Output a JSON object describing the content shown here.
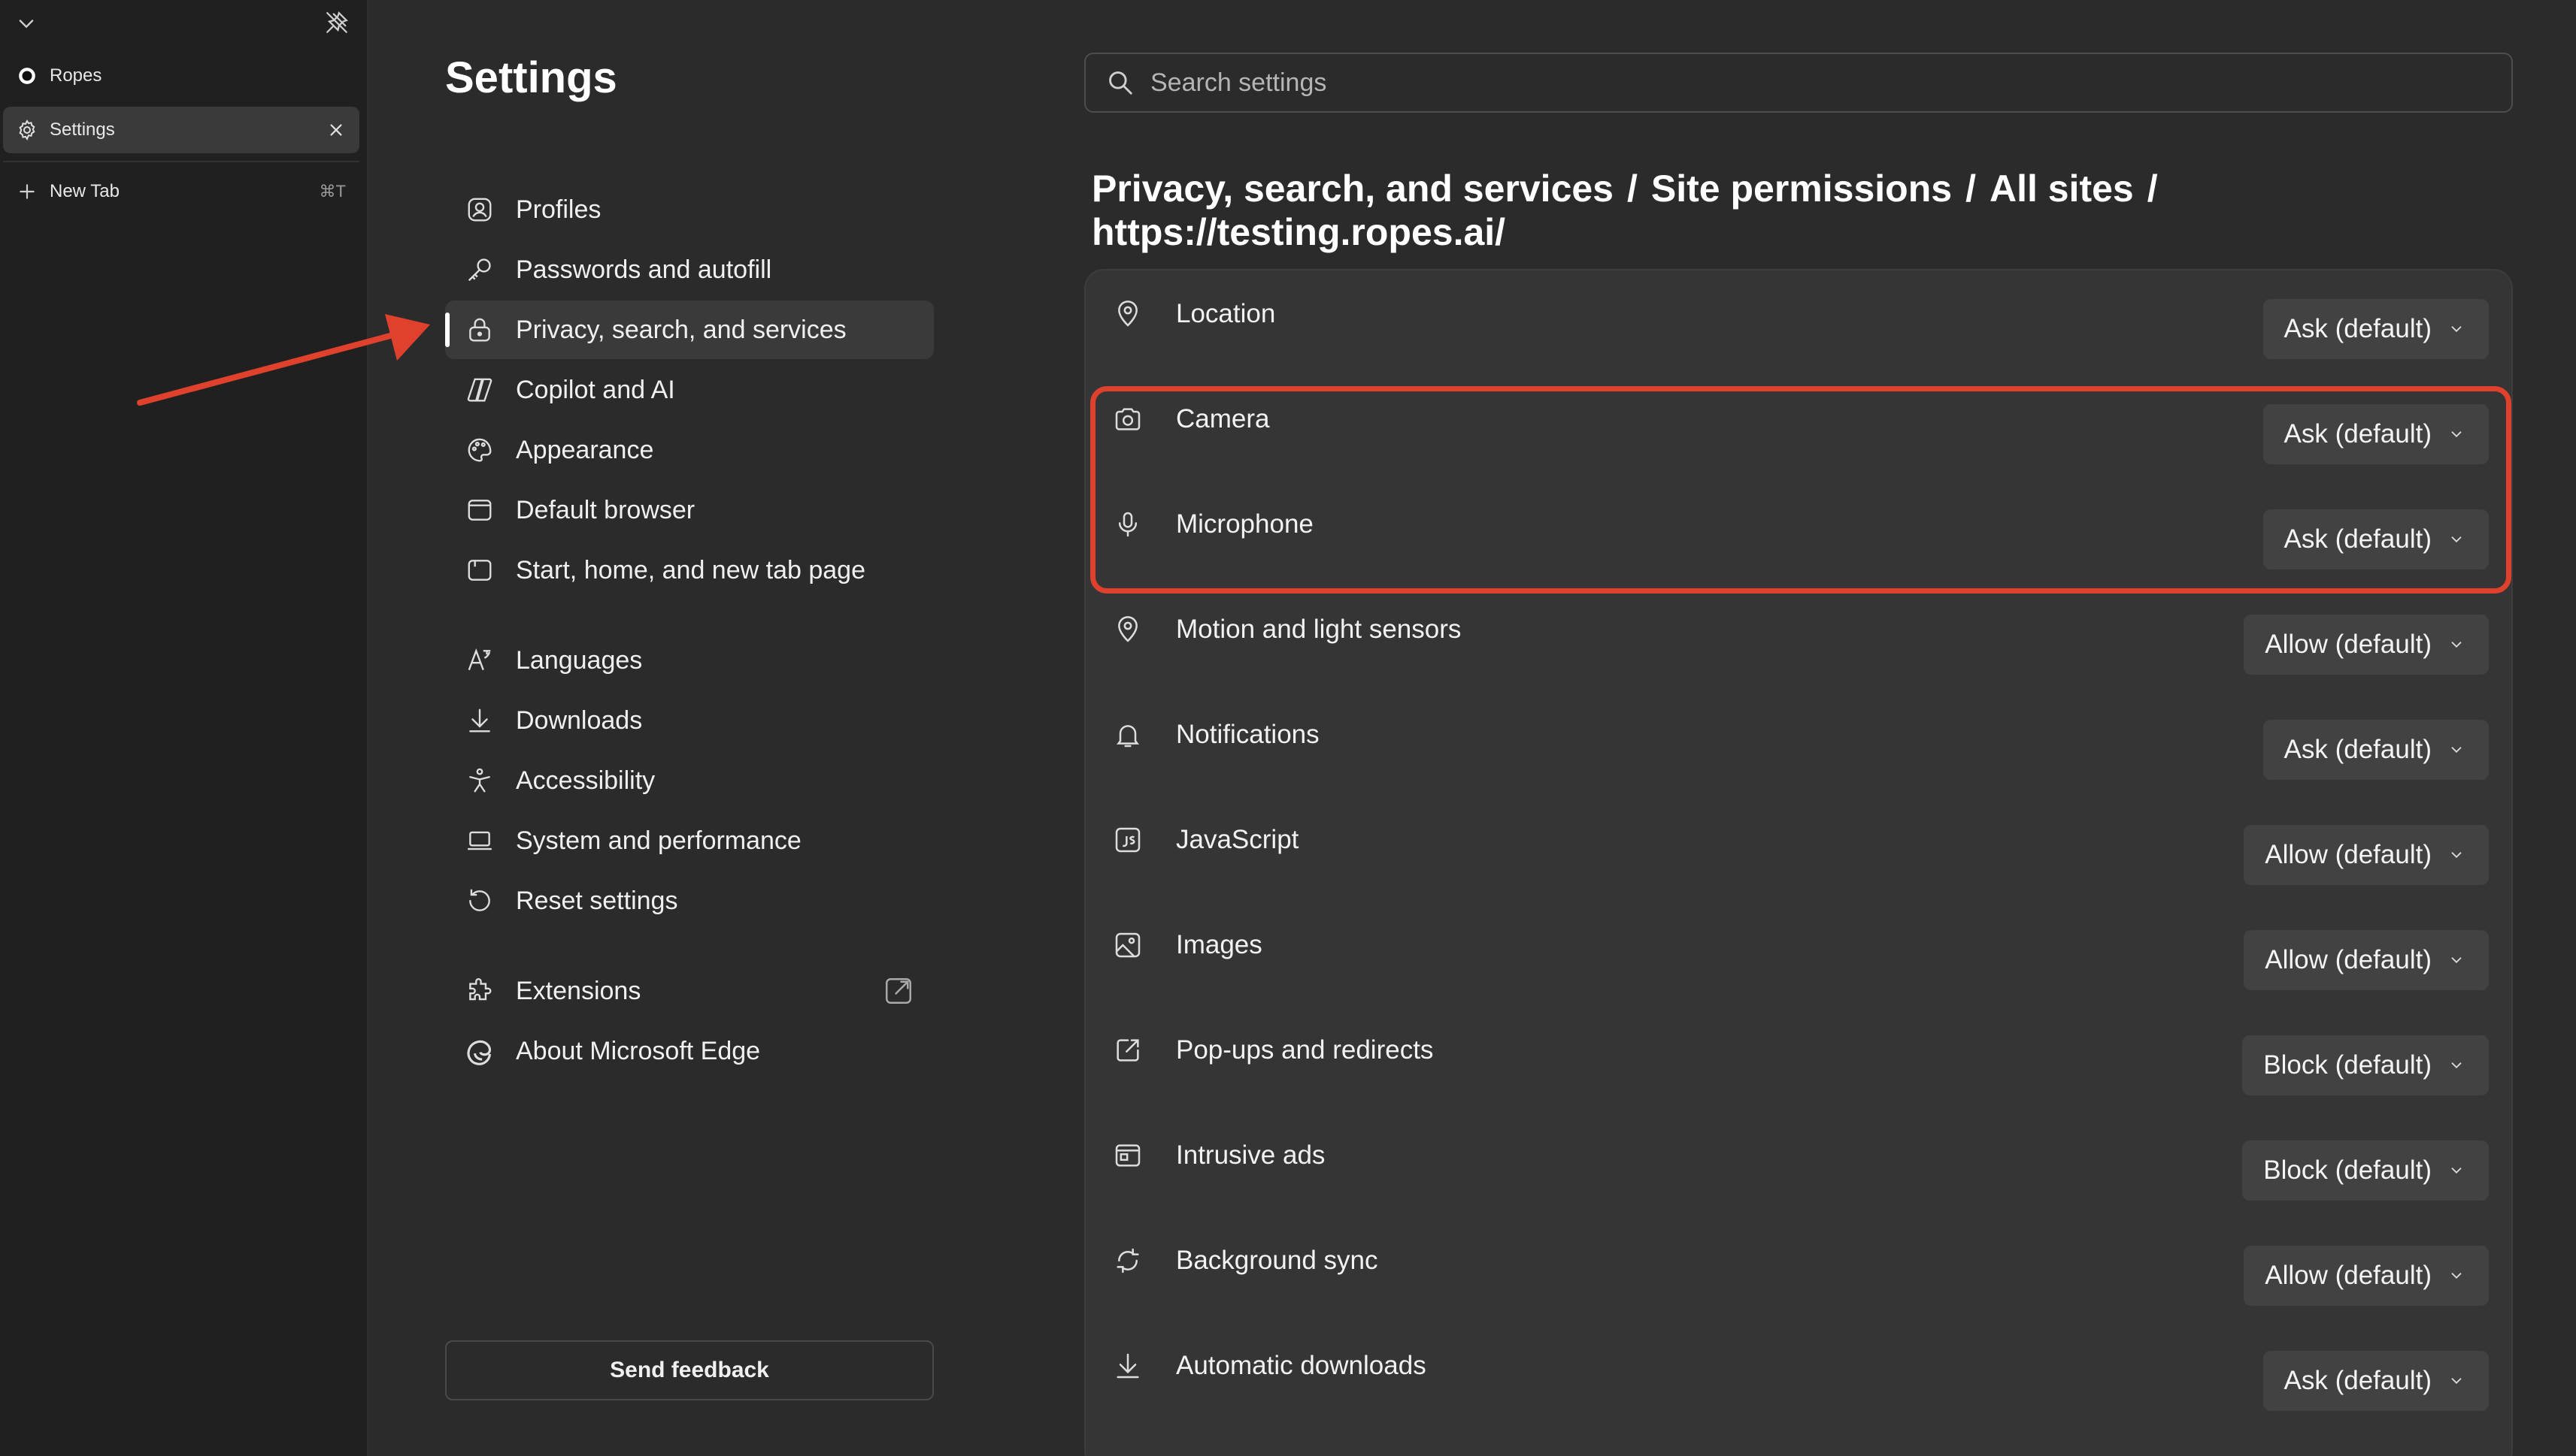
{
  "tabbar": {
    "tabs": [
      {
        "label": "Ropes",
        "icon": "site-dot-icon"
      },
      {
        "label": "Settings",
        "icon": "gear-icon",
        "active": true
      }
    ],
    "new_tab": {
      "label": "New Tab",
      "shortcut": "⌘T"
    }
  },
  "settings": {
    "title": "Settings",
    "nav": [
      {
        "label": "Profiles",
        "icon": "profile-icon"
      },
      {
        "label": "Passwords and autofill",
        "icon": "key-icon"
      },
      {
        "label": "Privacy, search, and services",
        "icon": "lock-icon",
        "active": true
      },
      {
        "label": "Copilot and AI",
        "icon": "copilot-icon"
      },
      {
        "label": "Appearance",
        "icon": "palette-icon"
      },
      {
        "label": "Default browser",
        "icon": "browser-icon"
      },
      {
        "label": "Start, home, and new tab page",
        "icon": "home-page-icon"
      },
      {
        "label": "Languages",
        "icon": "languages-icon"
      },
      {
        "label": "Downloads",
        "icon": "download-icon"
      },
      {
        "label": "Accessibility",
        "icon": "accessibility-icon"
      },
      {
        "label": "System and performance",
        "icon": "laptop-icon"
      },
      {
        "label": "Reset settings",
        "icon": "reset-icon"
      },
      {
        "label": "Extensions",
        "icon": "puzzle-icon"
      },
      {
        "label": "About Microsoft Edge",
        "icon": "edge-icon"
      }
    ],
    "feedback_label": "Send feedback"
  },
  "search": {
    "placeholder": "Search settings"
  },
  "breadcrumb": {
    "part1": "Privacy, search, and services",
    "part2": "Site permissions",
    "part3": "All sites",
    "part4": "https://testing.ropes.ai/",
    "separator": "/"
  },
  "permissions": [
    {
      "label": "Location",
      "value": "Ask (default)",
      "icon": "location-pin-icon"
    },
    {
      "label": "Camera",
      "value": "Ask (default)",
      "icon": "camera-icon"
    },
    {
      "label": "Microphone",
      "value": "Ask (default)",
      "icon": "microphone-icon"
    },
    {
      "label": "Motion and light sensors",
      "value": "Allow (default)",
      "icon": "sensor-pin-icon"
    },
    {
      "label": "Notifications",
      "value": "Ask (default)",
      "icon": "bell-icon"
    },
    {
      "label": "JavaScript",
      "value": "Allow (default)",
      "icon": "javascript-icon"
    },
    {
      "label": "Images",
      "value": "Allow (default)",
      "icon": "image-icon"
    },
    {
      "label": "Pop-ups and redirects",
      "value": "Block (default)",
      "icon": "popup-icon"
    },
    {
      "label": "Intrusive ads",
      "value": "Block (default)",
      "icon": "ads-icon"
    },
    {
      "label": "Background sync",
      "value": "Allow (default)",
      "icon": "sync-icon"
    },
    {
      "label": "Automatic downloads",
      "value": "Ask (default)",
      "icon": "download-icon"
    }
  ],
  "colors": {
    "annotation": "#e0412d",
    "background": "#2b2b2b",
    "panel": "#353535"
  }
}
